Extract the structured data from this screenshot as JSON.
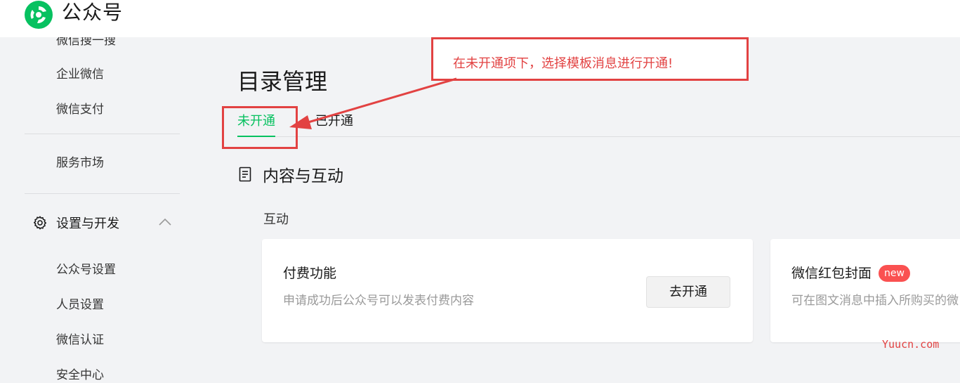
{
  "app": {
    "brand": "公众号"
  },
  "sidebar": {
    "items_top": [
      "微信搜一搜",
      "企业微信",
      "微信支付"
    ],
    "market": "服务市场",
    "group": {
      "label": "设置与开发",
      "icon": "gear-icon",
      "expanded": true
    },
    "group_items": [
      "公众号设置",
      "人员设置",
      "微信认证",
      "安全中心"
    ]
  },
  "main": {
    "title": "目录管理",
    "tabs": [
      {
        "label": "未开通",
        "active": true
      },
      {
        "label": "已开通",
        "active": false
      }
    ],
    "section": {
      "label": "内容与互动",
      "icon": "document-icon"
    },
    "subsection": "互动",
    "cards": [
      {
        "title": "付费功能",
        "desc": "申请成功后公众号可以发表付费内容",
        "button": "去开通"
      },
      {
        "title": "微信红包封面",
        "badge": "new",
        "desc": "可在图文消息中插入所购买的微"
      }
    ]
  },
  "annotation": {
    "text": "在未开通项下，选择模板消息进行开通!"
  },
  "watermark": "Yuucn.com",
  "colors": {
    "accent": "#07c160",
    "annotation": "#e24242",
    "badge": "#fa5151"
  }
}
